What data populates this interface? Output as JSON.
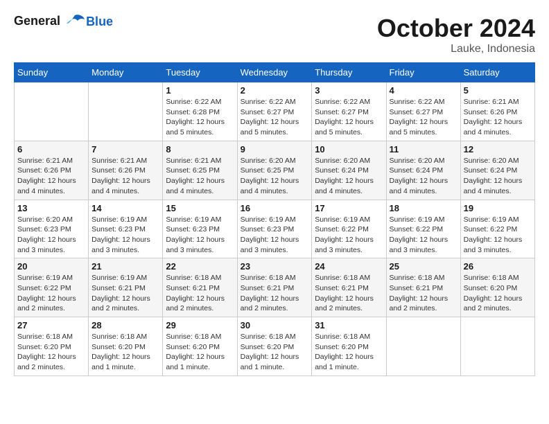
{
  "header": {
    "logo_line1": "General",
    "logo_line2": "Blue",
    "month_title": "October 2024",
    "location": "Lauke, Indonesia"
  },
  "weekdays": [
    "Sunday",
    "Monday",
    "Tuesday",
    "Wednesday",
    "Thursday",
    "Friday",
    "Saturday"
  ],
  "weeks": [
    [
      {
        "day": "",
        "info": ""
      },
      {
        "day": "",
        "info": ""
      },
      {
        "day": "1",
        "info": "Sunrise: 6:22 AM\nSunset: 6:28 PM\nDaylight: 12 hours\nand 5 minutes."
      },
      {
        "day": "2",
        "info": "Sunrise: 6:22 AM\nSunset: 6:27 PM\nDaylight: 12 hours\nand 5 minutes."
      },
      {
        "day": "3",
        "info": "Sunrise: 6:22 AM\nSunset: 6:27 PM\nDaylight: 12 hours\nand 5 minutes."
      },
      {
        "day": "4",
        "info": "Sunrise: 6:22 AM\nSunset: 6:27 PM\nDaylight: 12 hours\nand 5 minutes."
      },
      {
        "day": "5",
        "info": "Sunrise: 6:21 AM\nSunset: 6:26 PM\nDaylight: 12 hours\nand 4 minutes."
      }
    ],
    [
      {
        "day": "6",
        "info": "Sunrise: 6:21 AM\nSunset: 6:26 PM\nDaylight: 12 hours\nand 4 minutes."
      },
      {
        "day": "7",
        "info": "Sunrise: 6:21 AM\nSunset: 6:26 PM\nDaylight: 12 hours\nand 4 minutes."
      },
      {
        "day": "8",
        "info": "Sunrise: 6:21 AM\nSunset: 6:25 PM\nDaylight: 12 hours\nand 4 minutes."
      },
      {
        "day": "9",
        "info": "Sunrise: 6:20 AM\nSunset: 6:25 PM\nDaylight: 12 hours\nand 4 minutes."
      },
      {
        "day": "10",
        "info": "Sunrise: 6:20 AM\nSunset: 6:24 PM\nDaylight: 12 hours\nand 4 minutes."
      },
      {
        "day": "11",
        "info": "Sunrise: 6:20 AM\nSunset: 6:24 PM\nDaylight: 12 hours\nand 4 minutes."
      },
      {
        "day": "12",
        "info": "Sunrise: 6:20 AM\nSunset: 6:24 PM\nDaylight: 12 hours\nand 4 minutes."
      }
    ],
    [
      {
        "day": "13",
        "info": "Sunrise: 6:20 AM\nSunset: 6:23 PM\nDaylight: 12 hours\nand 3 minutes."
      },
      {
        "day": "14",
        "info": "Sunrise: 6:19 AM\nSunset: 6:23 PM\nDaylight: 12 hours\nand 3 minutes."
      },
      {
        "day": "15",
        "info": "Sunrise: 6:19 AM\nSunset: 6:23 PM\nDaylight: 12 hours\nand 3 minutes."
      },
      {
        "day": "16",
        "info": "Sunrise: 6:19 AM\nSunset: 6:23 PM\nDaylight: 12 hours\nand 3 minutes."
      },
      {
        "day": "17",
        "info": "Sunrise: 6:19 AM\nSunset: 6:22 PM\nDaylight: 12 hours\nand 3 minutes."
      },
      {
        "day": "18",
        "info": "Sunrise: 6:19 AM\nSunset: 6:22 PM\nDaylight: 12 hours\nand 3 minutes."
      },
      {
        "day": "19",
        "info": "Sunrise: 6:19 AM\nSunset: 6:22 PM\nDaylight: 12 hours\nand 3 minutes."
      }
    ],
    [
      {
        "day": "20",
        "info": "Sunrise: 6:19 AM\nSunset: 6:22 PM\nDaylight: 12 hours\nand 2 minutes."
      },
      {
        "day": "21",
        "info": "Sunrise: 6:19 AM\nSunset: 6:21 PM\nDaylight: 12 hours\nand 2 minutes."
      },
      {
        "day": "22",
        "info": "Sunrise: 6:18 AM\nSunset: 6:21 PM\nDaylight: 12 hours\nand 2 minutes."
      },
      {
        "day": "23",
        "info": "Sunrise: 6:18 AM\nSunset: 6:21 PM\nDaylight: 12 hours\nand 2 minutes."
      },
      {
        "day": "24",
        "info": "Sunrise: 6:18 AM\nSunset: 6:21 PM\nDaylight: 12 hours\nand 2 minutes."
      },
      {
        "day": "25",
        "info": "Sunrise: 6:18 AM\nSunset: 6:21 PM\nDaylight: 12 hours\nand 2 minutes."
      },
      {
        "day": "26",
        "info": "Sunrise: 6:18 AM\nSunset: 6:20 PM\nDaylight: 12 hours\nand 2 minutes."
      }
    ],
    [
      {
        "day": "27",
        "info": "Sunrise: 6:18 AM\nSunset: 6:20 PM\nDaylight: 12 hours\nand 2 minutes."
      },
      {
        "day": "28",
        "info": "Sunrise: 6:18 AM\nSunset: 6:20 PM\nDaylight: 12 hours\nand 1 minute."
      },
      {
        "day": "29",
        "info": "Sunrise: 6:18 AM\nSunset: 6:20 PM\nDaylight: 12 hours\nand 1 minute."
      },
      {
        "day": "30",
        "info": "Sunrise: 6:18 AM\nSunset: 6:20 PM\nDaylight: 12 hours\nand 1 minute."
      },
      {
        "day": "31",
        "info": "Sunrise: 6:18 AM\nSunset: 6:20 PM\nDaylight: 12 hours\nand 1 minute."
      },
      {
        "day": "",
        "info": ""
      },
      {
        "day": "",
        "info": ""
      }
    ]
  ]
}
